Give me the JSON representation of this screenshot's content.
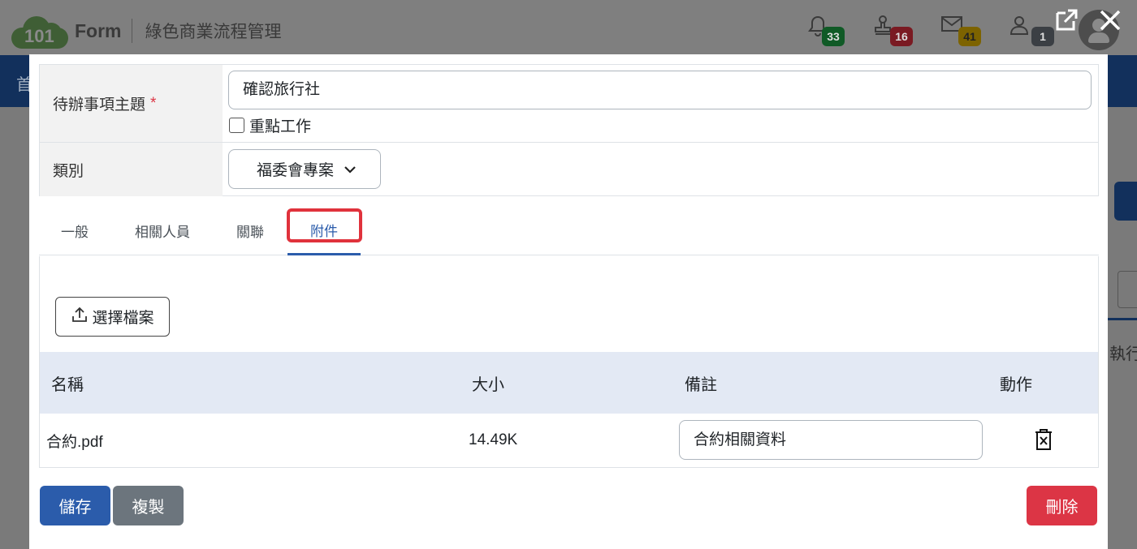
{
  "app": {
    "logo_number": "101",
    "logo_text": "Form",
    "title": "綠色商業流程管理",
    "nav_fragment": "首",
    "right_fragment_text": "執行",
    "badges": {
      "notifications": "33",
      "approvals": "16",
      "messages": "41",
      "users": "1"
    }
  },
  "form": {
    "subject_label": "待辦事項主題",
    "required_mark": "*",
    "subject_value": "確認旅行社",
    "important_label": "重點工作",
    "category_label": "類別",
    "category_value": "福委會專案"
  },
  "tabs": [
    "一般",
    "相關人員",
    "關聯",
    "附件"
  ],
  "attachments": {
    "pick_file_label": "選擇檔案",
    "headers": {
      "name": "名稱",
      "size": "大小",
      "note": "備註",
      "action": "動作"
    },
    "rows": [
      {
        "name": "合約.pdf",
        "size": "14.49K",
        "note": "合約相關資料"
      }
    ]
  },
  "buttons": {
    "save": "儲存",
    "copy": "複製",
    "delete": "刪除"
  },
  "colors": {
    "primary": "#2b5cab",
    "secondary": "#6c757d",
    "danger": "#dc3545",
    "highlight": "#e0323c",
    "table_header": "#e3e9f4"
  },
  "icons": [
    "bell-icon",
    "stamp-icon",
    "mail-icon",
    "user-icon",
    "external-link-icon",
    "close-icon",
    "chevron-down-icon",
    "upload-icon",
    "trash-icon"
  ]
}
